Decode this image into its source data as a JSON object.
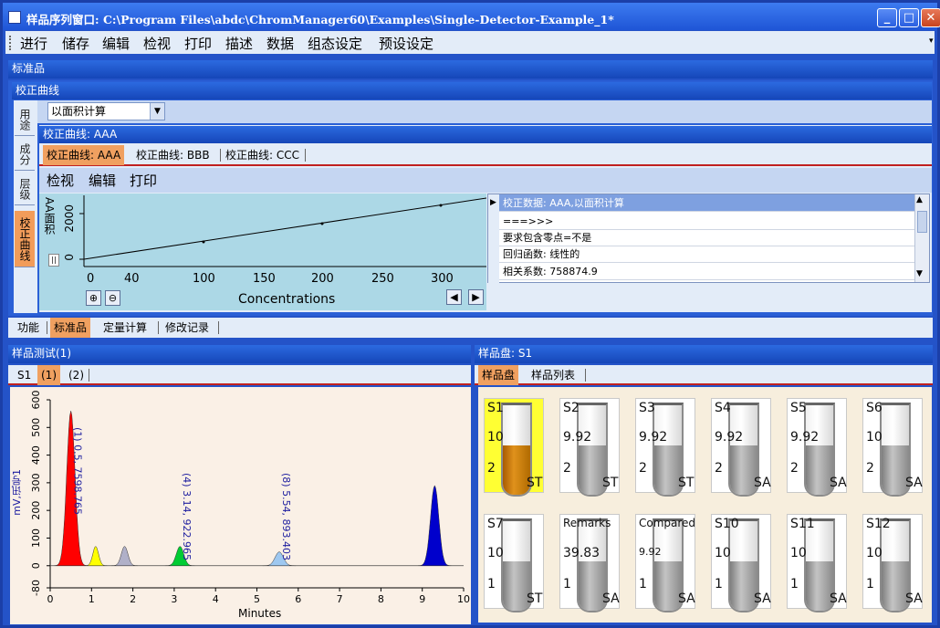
{
  "window": {
    "title": "样品序列窗口: C:\\Program Files\\abdc\\ChromManager60\\Examples\\Single-Detector-Example_1*"
  },
  "menu": [
    "进行",
    "储存",
    "编辑",
    "检视",
    "打印",
    "描述",
    "数据",
    "组态设定",
    "预设设定"
  ],
  "standards_panel": {
    "title": "标准品"
  },
  "calibration_panel": {
    "title": "校正曲线",
    "method_value": "以面积计算"
  },
  "vertical_tabs": [
    "用途",
    "成分",
    "层级",
    "校正曲线"
  ],
  "curve_panel": {
    "title": "校正曲线: AAA",
    "tabs": [
      "校正曲线: AAA",
      "校正曲线: BBB",
      "校正曲线: CCC"
    ],
    "toolbar": [
      "检视",
      "编辑",
      "打印"
    ]
  },
  "calib_chart": {
    "ylabel": "AA面积",
    "xlabel": "Concentrations",
    "yticks": [
      "2000",
      "0"
    ],
    "xticks": [
      "0",
      "40",
      "100",
      "150",
      "200",
      "250",
      "300"
    ]
  },
  "calib_grid": {
    "header": "校正数据: AAA,以面积计算",
    "rows": [
      "===>>>",
      "要求包含零点=不是",
      "回归函数: 线性的",
      "相关系数: 758874.9"
    ]
  },
  "bottom_tabs": [
    "功能",
    "标准品",
    "定量计算",
    "修改记录"
  ],
  "sample_test": {
    "title": "样品测试(1)",
    "tabs": [
      "S1",
      "(1)",
      "(2)"
    ]
  },
  "chrom_chart": {
    "ylabel": "mV,讯号1",
    "xlabel": "Minutes",
    "yticks": [
      "600",
      "500",
      "400",
      "300",
      "200",
      "100",
      "0",
      "-80"
    ],
    "xticks": [
      "0",
      "1",
      "2",
      "3",
      "4",
      "5",
      "6",
      "7",
      "8",
      "9",
      "10"
    ],
    "peak_labels": [
      "(1) 0.5, 7598.765",
      "(4) 3.14, 922.965",
      "(8) 5.54, 893.403"
    ]
  },
  "chart_data": {
    "type": "area",
    "title": "",
    "xlabel": "Minutes",
    "ylabel": "mV,讯号1",
    "xlim": [
      0,
      10
    ],
    "ylim": [
      -80,
      600
    ],
    "peaks": [
      {
        "rt": 0.5,
        "height": 560,
        "width": 0.1,
        "color": "#ff0000"
      },
      {
        "rt": 1.1,
        "height": 70,
        "width": 0.07,
        "color": "#ffff00"
      },
      {
        "rt": 1.8,
        "height": 70,
        "width": 0.08,
        "color": "#b0b0c8"
      },
      {
        "rt": 3.14,
        "height": 70,
        "width": 0.09,
        "color": "#00cc33"
      },
      {
        "rt": 5.54,
        "height": 50,
        "width": 0.1,
        "color": "#9ec8f0"
      },
      {
        "rt": 9.3,
        "height": 290,
        "width": 0.1,
        "color": "#0000cc"
      }
    ]
  },
  "tray": {
    "title": "样品盘: S1",
    "tabs": [
      "样品盘",
      "样品列表"
    ],
    "tubes": [
      {
        "name": "S1",
        "v1": "10",
        "v2": "2",
        "type": "ST",
        "sel": true
      },
      {
        "name": "S2",
        "v1": "9.92",
        "v2": "2",
        "type": "ST"
      },
      {
        "name": "S3",
        "v1": "9.92",
        "v2": "2",
        "type": "ST"
      },
      {
        "name": "S4",
        "v1": "9.92",
        "v2": "2",
        "type": "SA"
      },
      {
        "name": "S5",
        "v1": "9.92",
        "v2": "2",
        "type": "SA"
      },
      {
        "name": "S6",
        "v1": "10",
        "v2": "2",
        "type": "SA"
      },
      {
        "name": "S7",
        "v1": "10",
        "v2": "1",
        "type": "ST"
      },
      {
        "name": "Remarks",
        "v1": "39.83",
        "v2": "1",
        "type": "SA"
      },
      {
        "name": "Compared",
        "v1": "9.92",
        "v2": "1",
        "type": "SA"
      },
      {
        "name": "S10",
        "v1": "10",
        "v2": "1",
        "type": "SA"
      },
      {
        "name": "S11",
        "v1": "10",
        "v2": "1",
        "type": "SA"
      },
      {
        "name": "S12",
        "v1": "10",
        "v2": "1",
        "type": "SA"
      }
    ]
  }
}
